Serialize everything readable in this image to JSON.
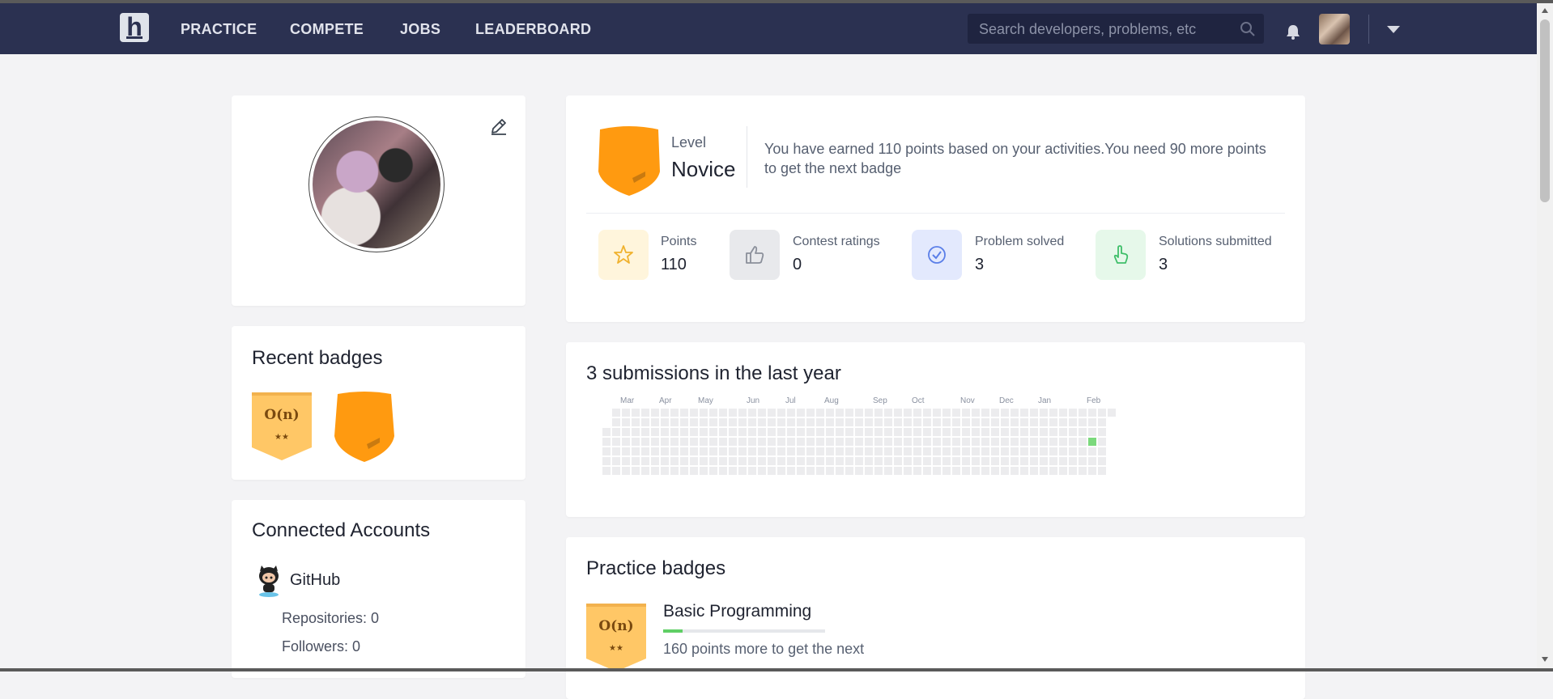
{
  "nav": {
    "logo_letter": "h",
    "items": [
      "PRACTICE",
      "COMPETE",
      "JOBS",
      "LEADERBOARD"
    ],
    "search_placeholder": "Search developers, problems, etc"
  },
  "profile": {
    "recent_badges_title": "Recent badges",
    "recent_badges": [
      {
        "text": "O(n)",
        "stars": "★★"
      },
      {
        "text": "",
        "stars": ""
      }
    ],
    "connected_title": "Connected Accounts",
    "github_label": "GitHub",
    "repositories": "Repositories: 0",
    "followers": "Followers: 0"
  },
  "level": {
    "label": "Level",
    "value": "Novice",
    "message": "You have earned 110 points based on your activities.You need 90 more points to get the next badge",
    "stats": [
      {
        "label": "Points",
        "value": "110",
        "icon": "star-icon",
        "bg": "#fff5dc",
        "fg": "#f0b22f"
      },
      {
        "label": "Contest ratings",
        "value": "0",
        "icon": "thumbs-up-icon",
        "bg": "#e8e9ec",
        "fg": "#8a8f9a"
      },
      {
        "label": "Problem solved",
        "value": "3",
        "icon": "check-circle-icon",
        "bg": "#e3e9fd",
        "fg": "#5b7fe8"
      },
      {
        "label": "Solutions submitted",
        "value": "3",
        "icon": "pointer-hand-icon",
        "bg": "#e6f8ea",
        "fg": "#3fbf6a"
      }
    ]
  },
  "activity": {
    "title": "3 submissions in the last year",
    "months": [
      "Mar",
      "Apr",
      "May",
      "Jun",
      "Jul",
      "Aug",
      "Sep",
      "Oct",
      "Nov",
      "Dec",
      "Jan",
      "Feb"
    ],
    "active_cells": [
      [
        50,
        3
      ]
    ]
  },
  "practice": {
    "title": "Practice badges",
    "badge_text": "O(n)",
    "badge_stars": "★★",
    "item_title": "Basic Programming",
    "progress": 0.12,
    "points_text": "160 points more to get the next"
  },
  "colors": {
    "navbar": "#2b3151",
    "badge_orange": "#ff9a10",
    "badge_light": "#ffc766"
  }
}
